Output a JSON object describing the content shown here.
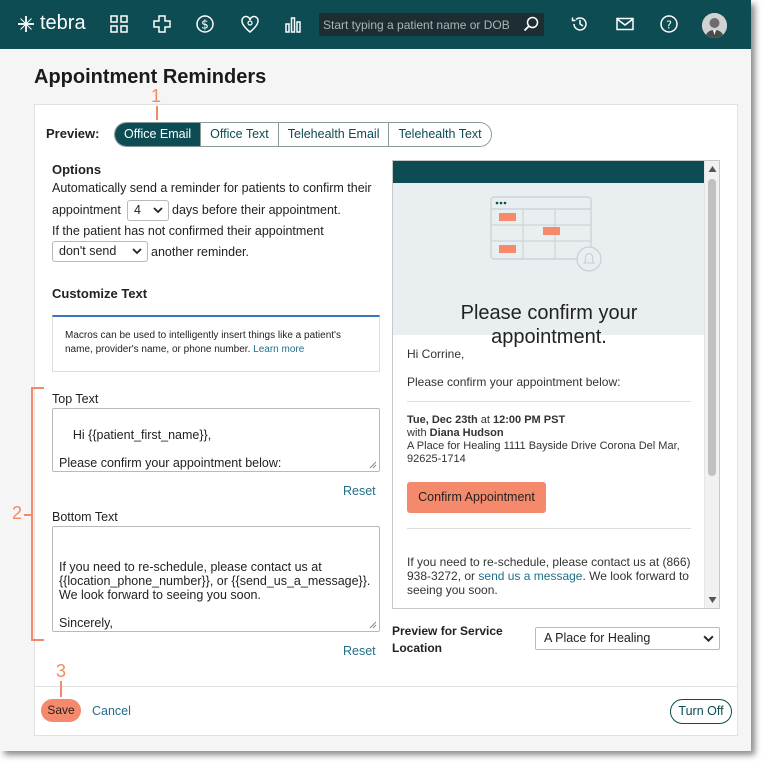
{
  "header": {
    "logo_text": "tebra",
    "search_placeholder": "Start typing a patient name or DOB"
  },
  "page": {
    "title": "Appointment Reminders"
  },
  "callouts": {
    "one": "1",
    "two": "2",
    "three": "3"
  },
  "preview": {
    "label": "Preview:",
    "tabs": [
      "Office Email",
      "Office Text",
      "Telehealth Email",
      "Telehealth Text"
    ],
    "active_tab": "Office Email"
  },
  "options": {
    "title": "Options",
    "line1": "Automatically send a reminder for patients to confirm their",
    "line2_pre": "appointment",
    "days_value": "4",
    "line2_post": "days before their appointment.",
    "line3": "If the patient has not confirmed their appointment",
    "resend_value": "don't send",
    "line4_post": "another reminder."
  },
  "customize": {
    "title": "Customize Text",
    "macro_text": "Macros can be used to intelligently insert things like a patient's name, provider's name, or phone number.",
    "macro_link": "Learn more",
    "top_label": "Top Text",
    "top_value": "Hi {{patient_first_name}},\n\nPlease confirm your appointment below:",
    "reset_label": "Reset",
    "bottom_label": "Bottom Text",
    "bottom_value": "\nIf you need to re-schedule, please contact us at {{location_phone_number}}, or {{send_us_a_message}}. We look forward to seeing you soon.\n\nSincerely,\n{{provider_name}}"
  },
  "email_preview": {
    "hero_title": "Please confirm your appointment.",
    "greeting": "Hi Corrine,",
    "intro": "Please confirm your appointment below:",
    "appt_date": "Tue, Dec 23th",
    "appt_at": "at",
    "appt_time": "12:00 PM PST",
    "with_label": "with",
    "provider": "Diana Hudson",
    "location": "A Place for Healing 1111 Bayside Drive Corona Del Mar, 92625-1714",
    "confirm_button": "Confirm Appointment",
    "closing_pre": "If you need to re-schedule, please contact us at (866) 938-3272, or",
    "closing_link": "send us a message",
    "closing_post": ". We look forward to seeing you soon."
  },
  "service_location": {
    "label": "Preview for Service Location",
    "value": "A Place for Healing"
  },
  "footer": {
    "save": "Save",
    "cancel": "Cancel",
    "turn_off": "Turn Off"
  },
  "colors": {
    "brand": "#0c4c52",
    "accent": "#f5896b",
    "callout": "#f08a67",
    "link": "#1f6f8b"
  }
}
